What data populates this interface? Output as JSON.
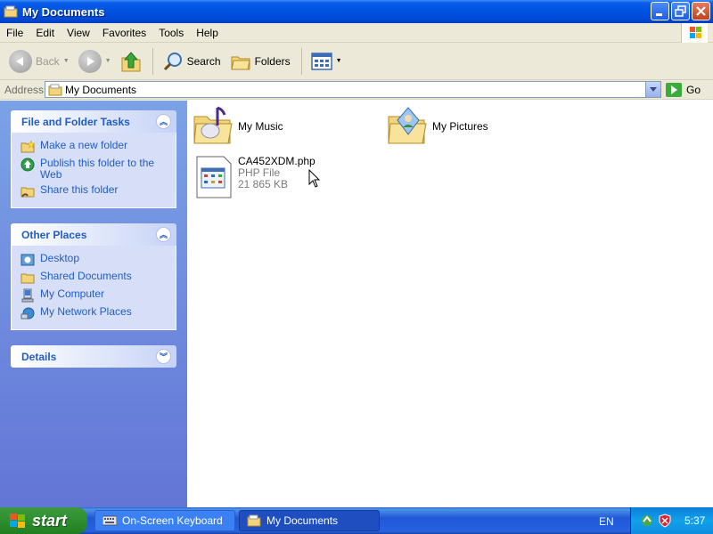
{
  "window": {
    "title": "My Documents",
    "title_icon": "folder-icon",
    "buttons": {
      "minimize": "minimize-icon",
      "maximize": "restore-icon",
      "close": "close-icon"
    }
  },
  "menu": {
    "items": [
      "File",
      "Edit",
      "View",
      "Favorites",
      "Tools",
      "Help"
    ]
  },
  "toolbar": {
    "back": "Back",
    "search": "Search",
    "folders": "Folders"
  },
  "address": {
    "label": "Address",
    "value": "My Documents",
    "go": "Go"
  },
  "left_panel": {
    "file_tasks": {
      "title": "File and Folder Tasks",
      "links": [
        "Make a new folder",
        "Publish this folder to the Web",
        "Share this folder"
      ]
    },
    "other_places": {
      "title": "Other Places",
      "links": [
        "Desktop",
        "Shared Documents",
        "My Computer",
        "My Network Places"
      ]
    },
    "details": {
      "title": "Details"
    }
  },
  "content": {
    "items": [
      {
        "name": "My Music",
        "icon": "music-folder-icon"
      },
      {
        "name": "My Pictures",
        "icon": "pictures-folder-icon"
      },
      {
        "name": "CA452XDM.php",
        "type": "PHP File",
        "size": "21 865 KB",
        "icon": "php-file-icon"
      }
    ]
  },
  "taskbar": {
    "start": "start",
    "buttons": [
      "On-Screen Keyboard",
      "My Documents"
    ],
    "language": "EN",
    "clock": "5:37"
  },
  "colors": {
    "title_bar": "#0054e3",
    "task_link": "#215dc6",
    "left_panel": "#7ba2e7",
    "start_green": "#2f8e2f"
  }
}
